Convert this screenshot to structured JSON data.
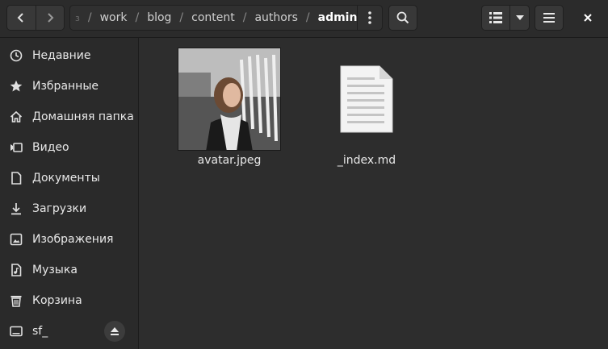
{
  "header": {
    "path_fragment": "з",
    "path": [
      "work",
      "blog",
      "content",
      "authors",
      "admin"
    ]
  },
  "sidebar": {
    "items": [
      {
        "label": "Недавние",
        "icon": "clock-icon"
      },
      {
        "label": "Избранные",
        "icon": "star-icon"
      },
      {
        "label": "Домашняя папка",
        "icon": "home-icon"
      },
      {
        "label": "Видео",
        "icon": "video-icon"
      },
      {
        "label": "Документы",
        "icon": "document-icon"
      },
      {
        "label": "Загрузки",
        "icon": "download-icon"
      },
      {
        "label": "Изображения",
        "icon": "image-icon"
      },
      {
        "label": "Музыка",
        "icon": "music-icon"
      },
      {
        "label": "Корзина",
        "icon": "trash-icon"
      },
      {
        "label": "sf_",
        "icon": "drive-icon"
      }
    ]
  },
  "files": [
    {
      "name": "avatar.jpeg",
      "type": "image"
    },
    {
      "name": "_index.md",
      "type": "text"
    }
  ],
  "colors": {
    "background": "#2d2d2d",
    "sidebar": "#2a2a2a",
    "text": "#eeeeec"
  }
}
